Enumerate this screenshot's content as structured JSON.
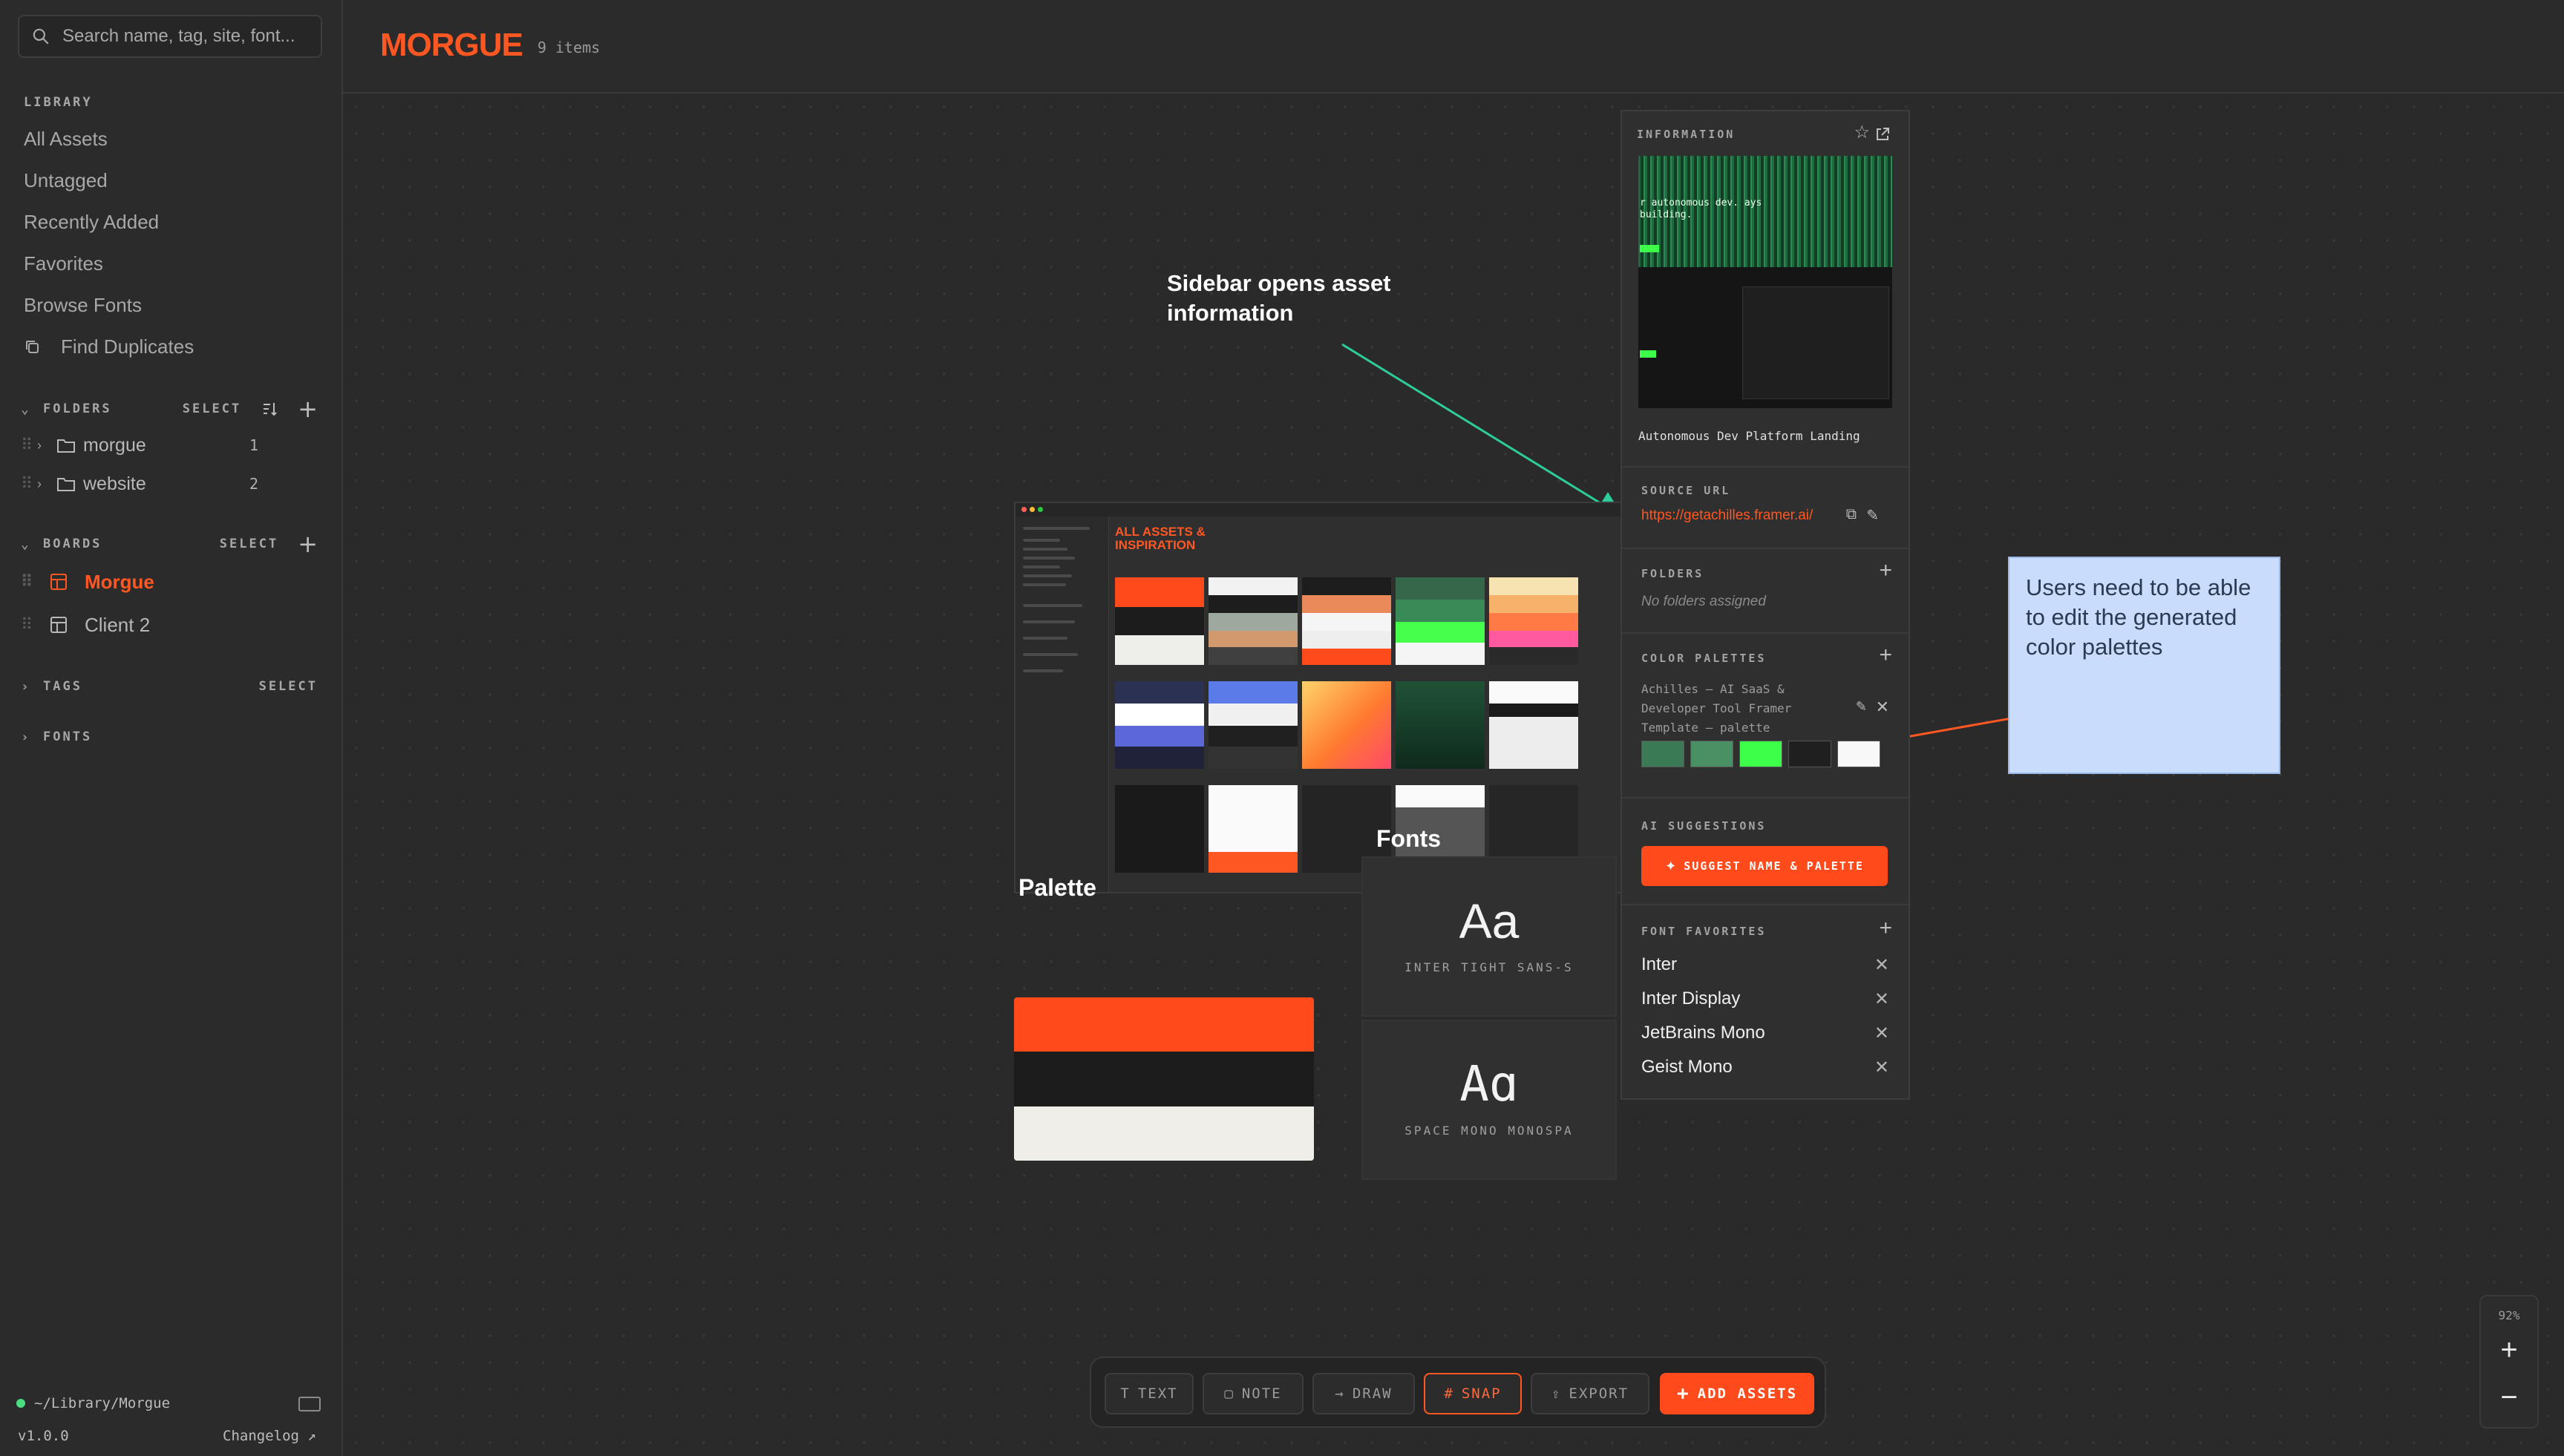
{
  "sidebar": {
    "search_placeholder": "Search name, tag, site, font...",
    "library_label": "LIBRARY",
    "library_items": [
      "All Assets",
      "Untagged",
      "Recently Added",
      "Favorites",
      "Browse Fonts",
      "Find Duplicates"
    ],
    "folders": {
      "label": "FOLDERS",
      "select": "SELECT",
      "items": [
        {
          "name": "morgue",
          "count": "1"
        },
        {
          "name": "website",
          "count": "2"
        }
      ]
    },
    "boards": {
      "label": "BOARDS",
      "select": "SELECT",
      "items": [
        {
          "name": "Morgue",
          "active": true
        },
        {
          "name": "Client 2",
          "active": false
        }
      ]
    },
    "tags": {
      "label": "TAGS",
      "select": "SELECT"
    },
    "fonts": {
      "label": "FONTS"
    },
    "footer": {
      "path": "~/Library/Morgue",
      "version": "v1.0.0",
      "changelog": "Changelog ↗"
    }
  },
  "header": {
    "title": "MORGUE",
    "item_count": "9 items"
  },
  "canvas": {
    "annotation_sidebar": "Sidebar opens asset information",
    "palette_caption": "Palette",
    "fonts_caption": "Fonts",
    "screenshot": {
      "title": "ALL ASSETS & INSPIRATION"
    },
    "palette_colors": [
      "#ff4a1c",
      "#1c1c1c",
      "#efeee9"
    ],
    "font_cards": [
      {
        "glyph": "Aa",
        "name": "INTER TIGHT SANS-S"
      },
      {
        "glyph": "Aɑ",
        "name": "SPACE MONO MONOSPA"
      }
    ],
    "sticky_note": "Users need to be able to edit the generated color palettes"
  },
  "info_panel": {
    "header": "INFORMATION",
    "asset_name": "Autonomous Dev Platform Landing",
    "source_url_label": "SOURCE URL",
    "source_url": "https://getachilles.framer.ai/",
    "folders_label": "FOLDERS",
    "folders_empty": "No folders assigned",
    "color_palettes_label": "COLOR PALETTES",
    "palette_name": "Achilles — AI SaaS & Developer Tool Framer Template — palette",
    "swatches": [
      "#3a7a55",
      "#4a9065",
      "#3dff4a",
      "#1f1f1f",
      "#f8f8f8"
    ],
    "ai_label": "AI SUGGESTIONS",
    "ai_button": "SUGGEST NAME & PALETTE",
    "font_favorites_label": "FONT FAVORITES",
    "fonts": [
      "Inter",
      "Inter Display",
      "JetBrains Mono",
      "Geist Mono"
    ],
    "preview_text": "r autonomous dev. ays building."
  },
  "toolbar": {
    "text": "TEXT",
    "note": "NOTE",
    "draw": "DRAW",
    "snap": "SNAP",
    "export": "EXPORT",
    "add_assets": "ADD ASSETS"
  },
  "zoom": {
    "level": "92%",
    "plus": "+",
    "minus": "−"
  },
  "colors": {
    "accent": "#ff5722",
    "annotation_arrow": "#2ecc9a",
    "sticky_arrow": "#ff5722",
    "sticky_bg": "#c9dcfb"
  }
}
